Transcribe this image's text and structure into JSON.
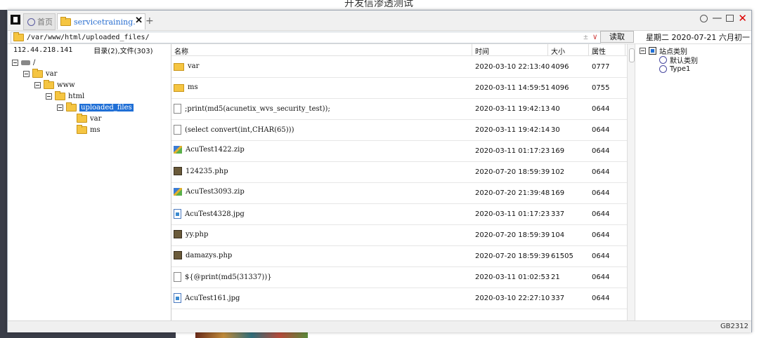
{
  "background": {
    "title": "开发信渗透测试"
  },
  "tabs": [
    {
      "label": "首页"
    },
    {
      "label": "servicetraining.q"
    }
  ],
  "address": {
    "path": "/var/www/html/uploaded_files/",
    "read_label": "读取"
  },
  "date_text": "星期二  2020-07-21  六月初一",
  "left": {
    "ip": "112.44.218.141",
    "count": "目录(2),文件(303)"
  },
  "tree": [
    {
      "label": "/"
    },
    {
      "label": "var"
    },
    {
      "label": "www"
    },
    {
      "label": "html"
    },
    {
      "label": "uploaded_files"
    },
    {
      "label": "var"
    },
    {
      "label": "ms"
    }
  ],
  "columns": {
    "name": "名称",
    "time": "时间",
    "size": "大小",
    "attr": "属性"
  },
  "files": [
    {
      "name": "var",
      "type": "folder",
      "time": "2020-03-10 22:13:40",
      "size": "4096",
      "attr": "0777"
    },
    {
      "name": "ms",
      "type": "folder",
      "time": "2020-03-11 14:59:51",
      "size": "4096",
      "attr": "0755"
    },
    {
      "name": ";print(md5(acunetix_wvs_security_test));",
      "type": "doc",
      "time": "2020-03-11 19:42:13",
      "size": "40",
      "attr": "0644"
    },
    {
      "name": "(select convert(int,CHAR(65)))",
      "type": "doc",
      "time": "2020-03-11 19:42:14",
      "size": "30",
      "attr": "0644"
    },
    {
      "name": "AcuTest1422.zip",
      "type": "zip",
      "time": "2020-03-11 01:17:23",
      "size": "169",
      "attr": "0644"
    },
    {
      "name": "124235.php",
      "type": "php",
      "time": "2020-07-20 18:59:39",
      "size": "102",
      "attr": "0644"
    },
    {
      "name": "AcuTest3093.zip",
      "type": "zip",
      "time": "2020-07-20 21:39:48",
      "size": "169",
      "attr": "0644"
    },
    {
      "name": "AcuTest4328.jpg",
      "type": "jpg",
      "time": "2020-03-11 01:17:23",
      "size": "337",
      "attr": "0644"
    },
    {
      "name": "yy.php",
      "type": "php",
      "time": "2020-07-20 18:59:39",
      "size": "104",
      "attr": "0644"
    },
    {
      "name": "damazys.php",
      "type": "php",
      "time": "2020-07-20 18:59:39",
      "size": "61505",
      "attr": "0644"
    },
    {
      "name": "${@print(md5(31337))}",
      "type": "doc",
      "time": "2020-03-11 01:02:53",
      "size": "21",
      "attr": "0644"
    },
    {
      "name": "AcuTest161.jpg",
      "type": "jpg",
      "time": "2020-03-10 22:27:10",
      "size": "337",
      "attr": "0644"
    }
  ],
  "site_tree": [
    {
      "label": "站点类别"
    },
    {
      "label": "默认类别"
    },
    {
      "label": "Type1"
    }
  ],
  "status": {
    "encoding": "GB2312"
  },
  "colors": {
    "selection": "#1f6fd6",
    "close": "#dd0000",
    "tab_active_text": "#2a6fd0"
  }
}
